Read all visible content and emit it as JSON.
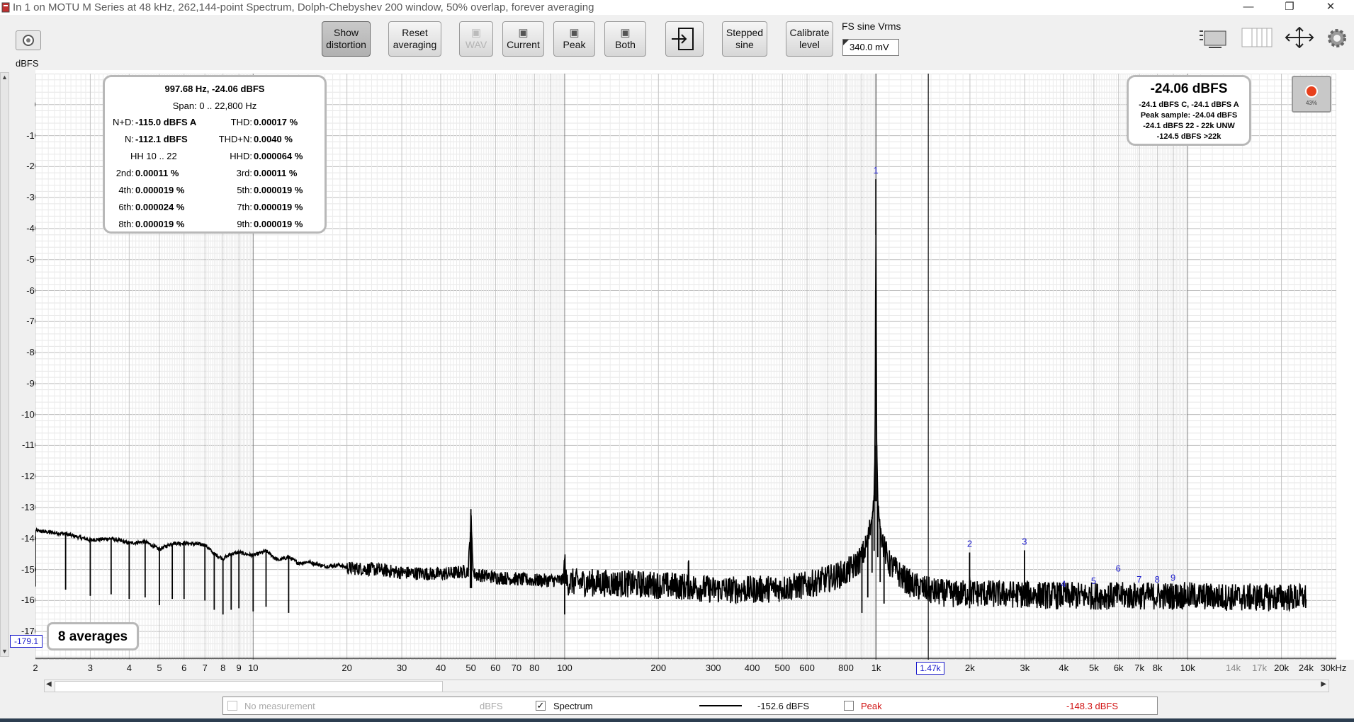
{
  "window": {
    "title": "In 1 on MOTU M Series at 48 kHz, 262,144-point Spectrum, Dolph-Chebyshev 200 window, 50% overlap, forever averaging",
    "minimize": "—",
    "restore": "❐",
    "close": "✕"
  },
  "toolbar": {
    "show_distortion": [
      "Show",
      "distortion"
    ],
    "reset_averaging": [
      "Reset",
      "averaging"
    ],
    "wav": "WAV",
    "current": "Current",
    "peak": "Peak",
    "both": "Both",
    "stepped_sine": [
      "Stepped",
      "sine"
    ],
    "calibrate_level": [
      "Calibrate",
      "level"
    ],
    "fs_sine_label": "FS sine Vrms",
    "fs_sine_value": "340.0 mV"
  },
  "distortion_box": {
    "header": "997.68 Hz, -24.06 dBFS",
    "span": "Span: 0 .. 22,800 Hz",
    "rows": [
      [
        {
          "label": "N+D:",
          "value": "-115.0 dBFS A"
        },
        {
          "label": "THD:",
          "value": "0.00017 %"
        }
      ],
      [
        {
          "label": "N:",
          "value": "-112.1 dBFS"
        },
        {
          "label": "THD+N:",
          "value": "0.0040 %"
        }
      ],
      [
        {
          "label": "",
          "value": "HH 10 .. 22"
        },
        {
          "label": "HHD:",
          "value": "0.000064 %"
        }
      ],
      [
        {
          "label": "2nd:",
          "value": "0.00011 %"
        },
        {
          "label": "3rd:",
          "value": "0.00011 %"
        }
      ],
      [
        {
          "label": "4th:",
          "value": "0.000019 %"
        },
        {
          "label": "5th:",
          "value": "0.000019 %"
        }
      ],
      [
        {
          "label": "6th:",
          "value": "0.000024 %"
        },
        {
          "label": "7th:",
          "value": "0.000019 %"
        }
      ],
      [
        {
          "label": "8th:",
          "value": "0.000019 %"
        },
        {
          "label": "9th:",
          "value": "0.000019 %"
        }
      ]
    ]
  },
  "level_box": {
    "main": "-24.06 dBFS",
    "lines": [
      "-24.1 dBFS C, -24.1 dBFS A",
      "Peak sample: -24.04 dBFS",
      "-24.1 dBFS 22 - 22k UNW",
      "-124.5 dBFS >22k"
    ]
  },
  "record_indicator": "43%",
  "averages_label": "8 averages",
  "cursor_level_readout": "-179.1",
  "cursor_freq_readout": "1.47k",
  "colors": {
    "trace": "#000000",
    "harmonic_label": "#1a1acc",
    "peak_label": "#d01010",
    "readout_box": "#1a1acc"
  },
  "legend": {
    "no_measurement": "No measurement",
    "no_measurement_unit": "dBFS",
    "spectrum": "Spectrum",
    "spectrum_checked": "✓",
    "spectrum_value": "-152.6 dBFS",
    "peak": "Peak",
    "peak_value": "-148.3 dBFS"
  },
  "chart_data": {
    "type": "line",
    "ylabel": "dBFS",
    "xscale": "log",
    "xlim": [
      2,
      30000
    ],
    "ylim": [
      -179.1,
      10
    ],
    "y_ticks": [
      0,
      -10,
      -20,
      -30,
      -40,
      -50,
      -60,
      -70,
      -80,
      -90,
      -100,
      -110,
      -120,
      -130,
      -140,
      -150,
      -160,
      -170
    ],
    "x_tick_labels": [
      {
        "v": 2,
        "t": "2"
      },
      {
        "v": 3,
        "t": "3"
      },
      {
        "v": 4,
        "t": "4"
      },
      {
        "v": 5,
        "t": "5"
      },
      {
        "v": 6,
        "t": "6"
      },
      {
        "v": 7,
        "t": "7"
      },
      {
        "v": 8,
        "t": "8"
      },
      {
        "v": 9,
        "t": "9"
      },
      {
        "v": 10,
        "t": "10"
      },
      {
        "v": 20,
        "t": "20"
      },
      {
        "v": 30,
        "t": "30"
      },
      {
        "v": 40,
        "t": "40"
      },
      {
        "v": 50,
        "t": "50"
      },
      {
        "v": 60,
        "t": "60"
      },
      {
        "v": 70,
        "t": "70"
      },
      {
        "v": 80,
        "t": "80"
      },
      {
        "v": 100,
        "t": "100"
      },
      {
        "v": 200,
        "t": "200"
      },
      {
        "v": 300,
        "t": "300"
      },
      {
        "v": 400,
        "t": "400"
      },
      {
        "v": 500,
        "t": "500"
      },
      {
        "v": 600,
        "t": "600"
      },
      {
        "v": 800,
        "t": "800"
      },
      {
        "v": 1000,
        "t": "1k"
      },
      {
        "v": 2000,
        "t": "2k"
      },
      {
        "v": 3000,
        "t": "3k"
      },
      {
        "v": 4000,
        "t": "4k"
      },
      {
        "v": 5000,
        "t": "5k"
      },
      {
        "v": 6000,
        "t": "6k"
      },
      {
        "v": 7000,
        "t": "7k"
      },
      {
        "v": 8000,
        "t": "8k"
      },
      {
        "v": 10000,
        "t": "10k"
      },
      {
        "v": 14000,
        "t": "14k"
      },
      {
        "v": 17000,
        "t": "17k"
      },
      {
        "v": 20000,
        "t": "20k"
      },
      {
        "v": 24000,
        "t": "24k"
      },
      {
        "v": 30000,
        "t": "30kHz"
      }
    ],
    "cursor_freq": 1470,
    "fundamental_freq": 997.68,
    "series": [
      {
        "values": [
          [
            2,
            -137.5
          ],
          [
            2.5,
            -138.5
          ],
          [
            3,
            -140.5
          ],
          [
            3.5,
            -140.0
          ],
          [
            4,
            -141.5
          ],
          [
            4.5,
            -141.0
          ],
          [
            5,
            -143.5
          ],
          [
            5.5,
            -141.5
          ],
          [
            6,
            -141.5
          ],
          [
            7,
            -142.0
          ],
          [
            7.5,
            -145.0
          ],
          [
            8,
            -146.5
          ],
          [
            8.5,
            -145.0
          ],
          [
            9,
            -144.5
          ],
          [
            10,
            -145.5
          ],
          [
            11,
            -144.0
          ],
          [
            12,
            -147.0
          ],
          [
            13,
            -146.0
          ],
          [
            14,
            -148.0
          ],
          [
            15,
            -147.5
          ],
          [
            17,
            -149.0
          ],
          [
            19,
            -148.5
          ],
          [
            20,
            -149.5
          ],
          [
            25,
            -150.0
          ],
          [
            30,
            -151.0
          ],
          [
            40,
            -151.5
          ],
          [
            45,
            -151.0
          ],
          [
            49,
            -150.5
          ],
          [
            49.8,
            -138.0
          ],
          [
            50,
            -130.5
          ],
          [
            50.2,
            -138.0
          ],
          [
            51,
            -151.5
          ],
          [
            60,
            -152.5
          ],
          [
            80,
            -153.5
          ],
          [
            99,
            -153.5
          ],
          [
            100,
            -146.5
          ],
          [
            101,
            -154.0
          ],
          [
            150,
            -154.5
          ],
          [
            200,
            -155.0
          ],
          [
            249,
            -155.5
          ],
          [
            250,
            -148.0
          ],
          [
            251,
            -155.5
          ],
          [
            300,
            -156.5
          ],
          [
            400,
            -156.5
          ],
          [
            500,
            -156.0
          ],
          [
            600,
            -155.0
          ],
          [
            700,
            -153.0
          ],
          [
            800,
            -151.0
          ],
          [
            850,
            -149.0
          ],
          [
            900,
            -146.0
          ],
          [
            940,
            -141.0
          ],
          [
            970,
            -133.0
          ],
          [
            985,
            -126.0
          ],
          [
            992,
            -110.0
          ],
          [
            996,
            -60.0
          ],
          [
            997.68,
            -24.06
          ],
          [
            999.5,
            -60.0
          ],
          [
            1004,
            -110.0
          ],
          [
            1012,
            -128.0
          ],
          [
            1030,
            -136.0
          ],
          [
            1060,
            -143.0
          ],
          [
            1100,
            -148.0
          ],
          [
            1200,
            -152.0
          ],
          [
            1300,
            -155.0
          ],
          [
            1400,
            -156.0
          ],
          [
            1500,
            -157.0
          ],
          [
            1800,
            -158.0
          ],
          [
            1990,
            -157.5
          ],
          [
            1995.4,
            -144.5
          ],
          [
            2001,
            -157.5
          ],
          [
            2500,
            -158.0
          ],
          [
            2990,
            -158.0
          ],
          [
            2993.0,
            -143.8
          ],
          [
            2997,
            -158.0
          ],
          [
            4000,
            -158.5
          ],
          [
            5000,
            -158.5
          ],
          [
            6000,
            -158.5
          ],
          [
            8000,
            -158.5
          ],
          [
            10000,
            -158.5
          ],
          [
            15000,
            -159.0
          ],
          [
            20000,
            -159.0
          ],
          [
            24000,
            -159.0
          ]
        ]
      }
    ],
    "harmonic_markers": [
      {
        "label": "1",
        "x": 997.68,
        "y": -24.06
      },
      {
        "label": "2",
        "x": 1995.4,
        "y": -144.5
      },
      {
        "label": "3",
        "x": 2993.0,
        "y": -143.8
      },
      {
        "label": "4",
        "x": 3990.7,
        "y": -157.5
      },
      {
        "label": "5",
        "x": 4988.4,
        "y": -156.5
      },
      {
        "label": "6",
        "x": 5986.1,
        "y": -152.5
      },
      {
        "label": "7",
        "x": 6983.8,
        "y": -156.0
      },
      {
        "label": "8",
        "x": 7981.4,
        "y": -156.0
      },
      {
        "label": "9",
        "x": 8979.1,
        "y": -155.5
      }
    ]
  }
}
